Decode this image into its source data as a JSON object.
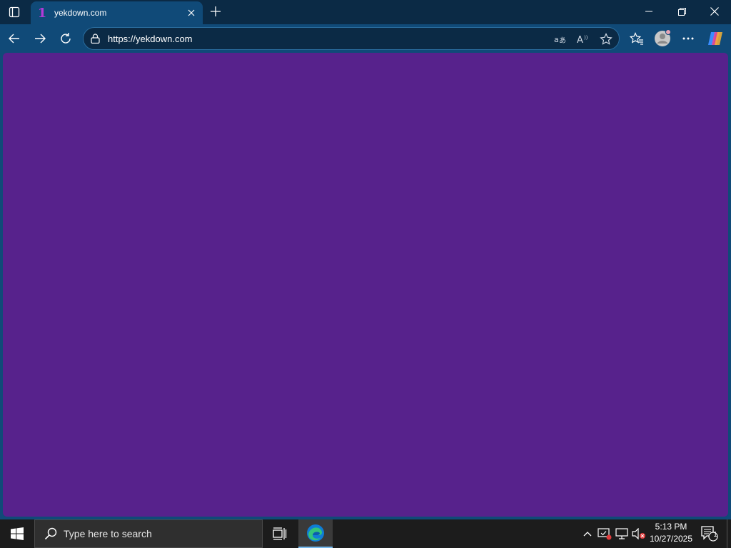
{
  "browser": {
    "tab": {
      "title": "yekdown.com",
      "favicon_glyph": "1",
      "favicon_color": "#b43ad8"
    },
    "address_bar": {
      "url": "https://yekdown.com"
    },
    "toolbar_icons": [
      "back-icon",
      "forward-icon",
      "refresh-icon",
      "lock-icon",
      "translate-icon",
      "read-aloud-icon",
      "favorite-star-icon",
      "favorites-icon",
      "profile-avatar",
      "more-icon",
      "copilot-icon"
    ],
    "colors": {
      "tab_bar": "#0b2a45",
      "toolbar": "#104a78",
      "page_background": "#57228c"
    }
  },
  "taskbar": {
    "search_placeholder": "Type here to search",
    "clock": {
      "time": "5:13 PM",
      "date": "10/27/2025"
    },
    "notification_count": "1"
  }
}
